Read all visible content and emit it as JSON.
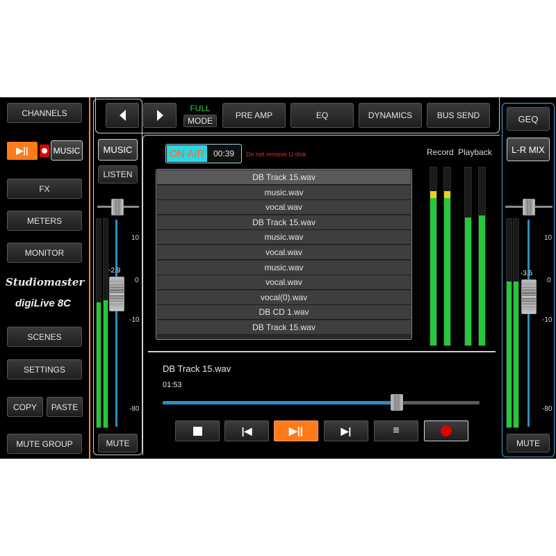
{
  "left_nav": {
    "channels": "CHANNELS",
    "music": "MUSIC",
    "fx": "FX",
    "meters": "METERS",
    "monitor": "MONITOR",
    "scenes": "SCENES",
    "settings": "SETTINGS",
    "copy": "COPY",
    "paste": "PASTE",
    "mute_group": "MUTE GROUP"
  },
  "brand": {
    "logo_text": "Studiomaster",
    "model_text": "digiLive 8C"
  },
  "top_bar": {
    "full": "FULL",
    "mode": "MODE",
    "tabs": [
      "PRE AMP",
      "EQ",
      "DYNAMICS",
      "BUS SEND"
    ]
  },
  "channel_strip": {
    "name": "MUSIC",
    "listen": "LISTEN",
    "fader_value": "-2.9",
    "fader_level": 0.45,
    "scale": [
      "10",
      "0",
      "-10",
      "-80"
    ],
    "meter_left": 0.6,
    "meter_right": 0.61,
    "mute": "MUTE"
  },
  "player": {
    "on_air": "ON AIR",
    "timer": "00:39",
    "warning": "Do not remove U disk",
    "record_label": "Record",
    "playback_label": "Playback",
    "record_meters": [
      0.83,
      0.83
    ],
    "playback_meters": [
      0.72,
      0.73
    ],
    "files": [
      "DB Track 15.wav",
      "music.wav",
      "vocal.wav",
      "DB Track 15.wav",
      "music.wav",
      "vocal.wav",
      "music.wav",
      "vocal.wav",
      "vocal(0).wav",
      "DB CD 1.wav",
      "DB Track 15.wav"
    ],
    "selected_index": 0,
    "now_playing": "DB Track 15.wav",
    "elapsed": "01:53",
    "progress": 0.74
  },
  "right_strip": {
    "geq": "GEQ",
    "bus_name": "L-R MIX",
    "fader_value": "-3.5",
    "fader_level": 0.44,
    "scale": [
      "10",
      "0",
      "-10",
      "-80"
    ],
    "meter_left": 0.7,
    "meter_right": 0.7,
    "mute": "MUTE"
  },
  "colors": {
    "accent_orange": "#ff7a1a",
    "meter_green": "#24c83a",
    "on_air_cyan": "#28d7e8",
    "record_red": "#e00000",
    "strip_blue": "#4aa8e0"
  }
}
